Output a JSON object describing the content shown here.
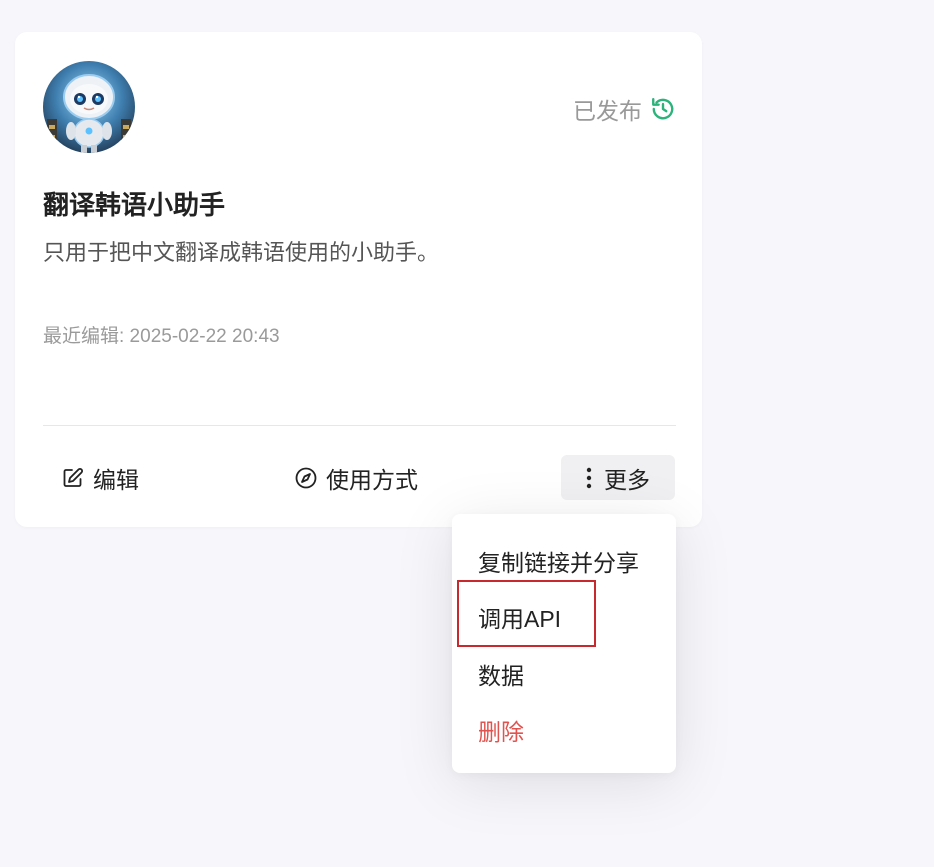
{
  "card": {
    "status_label": "已发布",
    "title": "翻译韩语小助手",
    "description": "只用于把中文翻译成韩语使用的小助手。",
    "last_edited": "最近编辑: 2025-02-22 20:43",
    "actions": {
      "edit": "编辑",
      "usage": "使用方式",
      "more": "更多"
    }
  },
  "menu": {
    "items": [
      {
        "label": "复制链接并分享"
      },
      {
        "label": "调用API"
      },
      {
        "label": "数据"
      },
      {
        "label": "删除"
      }
    ]
  },
  "colors": {
    "status_icon": "#2bb37b",
    "danger": "#e0534e",
    "highlight_border": "#c62a2f"
  },
  "icons": {
    "status": "history-icon",
    "edit": "edit-icon",
    "usage": "compass-icon",
    "more": "more-vertical-icon"
  }
}
